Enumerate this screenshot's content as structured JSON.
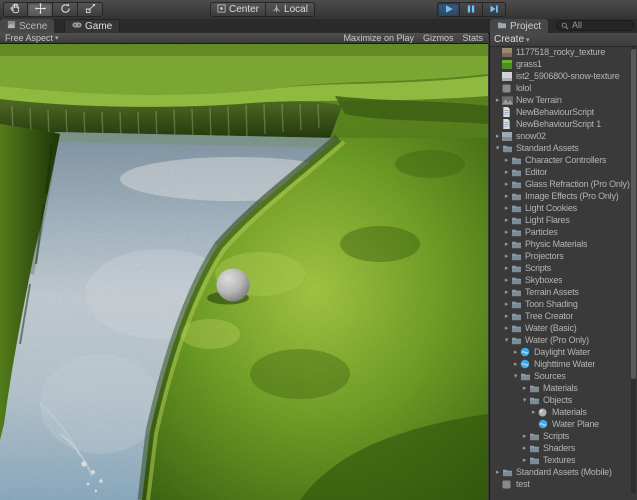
{
  "toolbar": {
    "tools": [
      {
        "name": "pan",
        "active": false
      },
      {
        "name": "move",
        "active": true
      },
      {
        "name": "rotate",
        "active": false
      },
      {
        "name": "scale",
        "active": false
      }
    ],
    "pivot_buttons": [
      {
        "label": "Center"
      },
      {
        "label": "Local"
      }
    ],
    "playback": [
      {
        "name": "play",
        "active": true
      },
      {
        "name": "pause",
        "active": false
      },
      {
        "name": "step",
        "active": false
      }
    ]
  },
  "tabs": {
    "scene": "Scene",
    "game": "Game",
    "project": "Project"
  },
  "game_toolbar": {
    "aspect": "Free Aspect",
    "maximize_on_play": "Maximize on Play",
    "gizmos": "Gizmos",
    "stats": "Stats"
  },
  "project_panel": {
    "create_label": "Create",
    "search_filter": "All",
    "rows": [
      {
        "label": "1177518_rocky_texture",
        "icon": "texture-rock",
        "indent": 0,
        "arrow": "none"
      },
      {
        "label": "grass1",
        "icon": "texture-grass",
        "indent": 0,
        "arrow": "none"
      },
      {
        "label": "ist2_5906800-snow-texture",
        "icon": "texture-snow",
        "indent": 0,
        "arrow": "none"
      },
      {
        "label": "lolol",
        "icon": "asset",
        "indent": 0,
        "arrow": "none"
      },
      {
        "label": "New Terrain",
        "icon": "terrain",
        "indent": 0,
        "arrow": "right"
      },
      {
        "label": "NewBehaviourScript",
        "icon": "script",
        "indent": 0,
        "arrow": "none"
      },
      {
        "label": "NewBehaviourScript 1",
        "icon": "script",
        "indent": 0,
        "arrow": "none"
      },
      {
        "label": "snow02",
        "icon": "texture-snow2",
        "indent": 0,
        "arrow": "right"
      },
      {
        "label": "Standard Assets",
        "icon": "folder",
        "indent": 0,
        "arrow": "down"
      },
      {
        "label": "Character Controllers",
        "icon": "folder",
        "indent": 1,
        "arrow": "right"
      },
      {
        "label": "Editor",
        "icon": "folder",
        "indent": 1,
        "arrow": "right"
      },
      {
        "label": "Glass Refraction (Pro Only)",
        "icon": "folder",
        "indent": 1,
        "arrow": "right"
      },
      {
        "label": "Image Effects (Pro Only)",
        "icon": "folder",
        "indent": 1,
        "arrow": "right"
      },
      {
        "label": "Light Cookies",
        "icon": "folder",
        "indent": 1,
        "arrow": "right"
      },
      {
        "label": "Light Flares",
        "icon": "folder",
        "indent": 1,
        "arrow": "right"
      },
      {
        "label": "Particles",
        "icon": "folder",
        "indent": 1,
        "arrow": "right"
      },
      {
        "label": "Physic Materials",
        "icon": "folder",
        "indent": 1,
        "arrow": "right"
      },
      {
        "label": "Projectors",
        "icon": "folder",
        "indent": 1,
        "arrow": "right"
      },
      {
        "label": "Scripts",
        "icon": "folder",
        "indent": 1,
        "arrow": "right"
      },
      {
        "label": "Skyboxes",
        "icon": "folder",
        "indent": 1,
        "arrow": "right"
      },
      {
        "label": "Terrain Assets",
        "icon": "folder",
        "indent": 1,
        "arrow": "right"
      },
      {
        "label": "Toon Shading",
        "icon": "folder",
        "indent": 1,
        "arrow": "right"
      },
      {
        "label": "Tree Creator",
        "icon": "folder",
        "indent": 1,
        "arrow": "right"
      },
      {
        "label": "Water (Basic)",
        "icon": "folder",
        "indent": 1,
        "arrow": "right"
      },
      {
        "label": "Water (Pro Only)",
        "icon": "folder",
        "indent": 1,
        "arrow": "down"
      },
      {
        "label": "Daylight Water",
        "icon": "water-prefab",
        "indent": 2,
        "arrow": "right"
      },
      {
        "label": "Nighttime Water",
        "icon": "water-prefab",
        "indent": 2,
        "arrow": "right"
      },
      {
        "label": "Sources",
        "icon": "folder",
        "indent": 2,
        "arrow": "down"
      },
      {
        "label": "Materials",
        "icon": "folder",
        "indent": 3,
        "arrow": "right"
      },
      {
        "label": "Objects",
        "icon": "folder",
        "indent": 3,
        "arrow": "down"
      },
      {
        "label": "Materials",
        "icon": "material",
        "indent": 4,
        "arrow": "right"
      },
      {
        "label": "Water Plane",
        "icon": "water-prefab",
        "indent": 4,
        "arrow": "none"
      },
      {
        "label": "Scripts",
        "icon": "folder",
        "indent": 3,
        "arrow": "right"
      },
      {
        "label": "Shaders",
        "icon": "folder",
        "indent": 3,
        "arrow": "right"
      },
      {
        "label": "Textures",
        "icon": "folder",
        "indent": 3,
        "arrow": "right"
      },
      {
        "label": "Standard Assets (Mobile)",
        "icon": "folder",
        "indent": 0,
        "arrow": "right"
      },
      {
        "label": "test",
        "icon": "asset",
        "indent": 0,
        "arrow": "none"
      }
    ]
  },
  "colors": {
    "playback_accent": "#6cc3ff",
    "grass_bright": "#a8d84a",
    "water": "#c8d8e4"
  }
}
